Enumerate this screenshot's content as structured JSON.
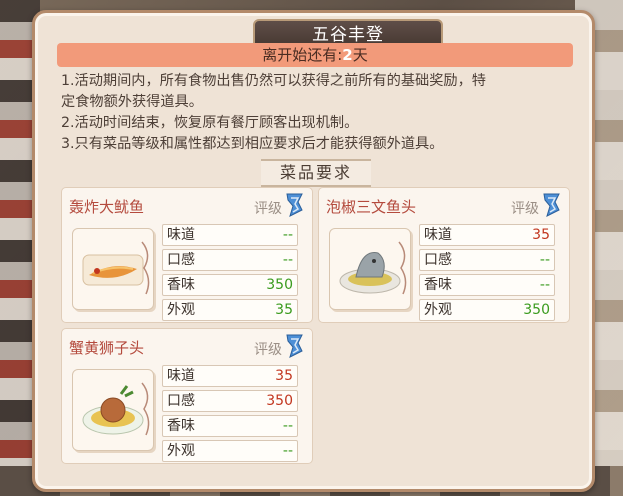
{
  "title": "五谷丰登",
  "banner": {
    "prefix": "离开始还有:",
    "days": "2",
    "suffix": "天"
  },
  "rules": [
    "1.活动期间内，所有食物出售仍然可以获得之前所有的基础奖励，特",
    "定食物额外获得道具。",
    "2.活动时间结束，恢复原有餐厅顾客出现机制。",
    "3.只有菜品等级和属性都达到相应要求后才能获得额外道具。"
  ],
  "section_title": "菜品要求",
  "grade_label": "评级",
  "attr_labels": [
    "味道",
    "口感",
    "香味",
    "外观"
  ],
  "dishes": [
    {
      "name": "轰炸大鱿鱼",
      "values": [
        "--",
        "--",
        "350",
        "35"
      ],
      "colors": [
        "green",
        "green",
        "green",
        "green"
      ]
    },
    {
      "name": "泡椒三文鱼头",
      "values": [
        "35",
        "--",
        "--",
        "350"
      ],
      "colors": [
        "red",
        "green",
        "green",
        "green"
      ]
    },
    {
      "name": "蟹黄狮子头",
      "values": [
        "35",
        "350",
        "--",
        "--"
      ],
      "colors": [
        "red",
        "red",
        "green",
        "green"
      ]
    }
  ],
  "colors": {
    "accent": "#f29a7a",
    "dish_name": "#b44a3d",
    "value_red": "#c2361f",
    "value_green": "#3a9b1e"
  },
  "icons": [
    "grade-badge-icon"
  ]
}
